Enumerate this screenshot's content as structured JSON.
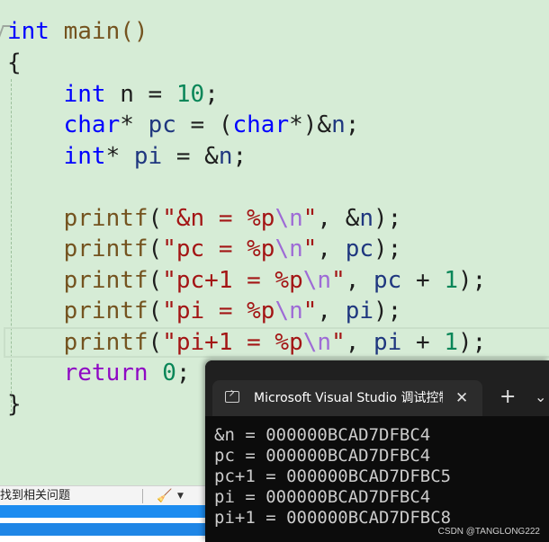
{
  "editor": {
    "lines": [
      [
        "int",
        " main()"
      ],
      [
        "{"
      ],
      [
        "    ",
        "int",
        " n = ",
        "10",
        ";"
      ],
      [
        "    ",
        "char",
        "* ",
        "pc",
        " = (",
        "char",
        "*)&",
        "n",
        ";"
      ],
      [
        "    ",
        "int",
        "* ",
        "pi",
        " = &",
        "n",
        ";"
      ],
      [
        ""
      ],
      [
        "    ",
        "printf",
        "(",
        "\"&n = %p",
        "\\n",
        "\"",
        ", &",
        "n",
        ");"
      ],
      [
        "    ",
        "printf",
        "(",
        "\"pc = %p",
        "\\n",
        "\"",
        ", ",
        "pc",
        ");"
      ],
      [
        "    ",
        "printf",
        "(",
        "\"pc+1 = %p",
        "\\n",
        "\"",
        ", ",
        "pc",
        " + ",
        "1",
        ");"
      ],
      [
        "    ",
        "printf",
        "(",
        "\"pi = %p",
        "\\n",
        "\"",
        ", ",
        "pi",
        ");"
      ],
      [
        "    ",
        "printf",
        "(",
        "\"pi+1 = %p",
        "\\n",
        "\"",
        ", ",
        "pi",
        " + ",
        "1",
        ");"
      ],
      [
        "    ",
        "return",
        " ",
        "0",
        ";"
      ],
      [
        "}"
      ]
    ]
  },
  "statusbar": {
    "issues_text": "找到相关问题",
    "broom_icon": "broom-icon",
    "dropdown_icon": "chevron-down-icon"
  },
  "console": {
    "title": "Microsoft Visual Studio 调试控制台",
    "close_glyph": "✕",
    "new_tab_glyph": "+",
    "menu_glyph": "⌄",
    "output": [
      "&n = 000000BCAD7DFBC4",
      "pc = 000000BCAD7DFBC4",
      "pc+1 = 000000BCAD7DFBC5",
      "pi = 000000BCAD7DFBC4",
      "pi+1 = 000000BCAD7DFBC8"
    ]
  },
  "watermark": "CSDN @TANGLONG222",
  "colors": {
    "editor_bg": "#d6ecd6",
    "keyword": "#0000ff",
    "function": "#74531f",
    "string": "#a31515",
    "escape": "#9e6bd6",
    "variable": "#1f377f",
    "control": "#8f08c4",
    "number": "#098658",
    "console_bg": "#0c0c0c"
  }
}
